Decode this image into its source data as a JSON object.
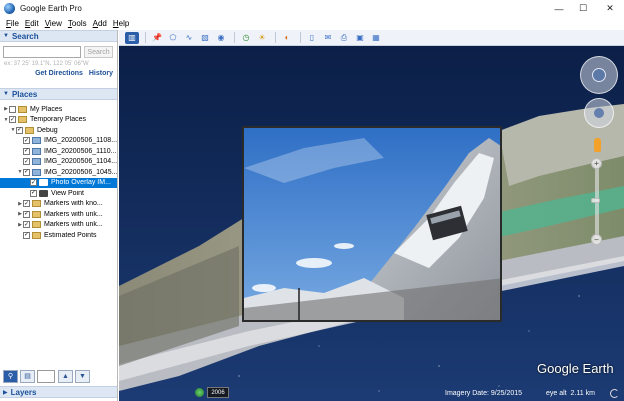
{
  "window": {
    "title": "Google Earth Pro",
    "minimize": "—",
    "maximize": "☐",
    "close": "✕"
  },
  "menu": [
    {
      "label": "File",
      "mn": "F"
    },
    {
      "label": "Edit",
      "mn": "E"
    },
    {
      "label": "View",
      "mn": "V"
    },
    {
      "label": "Tools",
      "mn": "T"
    },
    {
      "label": "Add",
      "mn": "A"
    },
    {
      "label": "Help",
      "mn": "H"
    }
  ],
  "search": {
    "header": "Search",
    "input_value": "",
    "button": "Search",
    "coords_hint": "ex: 37 25' 19.1\"N, 122 05' 06\"W",
    "get_directions": "Get Directions",
    "history": "History"
  },
  "places": {
    "header": "Places",
    "rows": [
      {
        "label": "My Places",
        "checked": false,
        "expander": "▶",
        "icon": "folder",
        "indent": 0,
        "selected": false
      },
      {
        "label": "Temporary Places",
        "checked": true,
        "expander": "▼",
        "icon": "folder",
        "indent": 0,
        "selected": false
      },
      {
        "label": "Debug",
        "checked": true,
        "expander": "▼",
        "icon": "folder",
        "indent": 1,
        "selected": false
      },
      {
        "label": "IMG_20200506_1108...",
        "checked": true,
        "expander": "",
        "icon": "img",
        "indent": 2,
        "selected": false
      },
      {
        "label": "IMG_20200506_1110...",
        "checked": true,
        "expander": "",
        "icon": "img",
        "indent": 2,
        "selected": false
      },
      {
        "label": "IMG_20200506_1104...",
        "checked": true,
        "expander": "",
        "icon": "img",
        "indent": 2,
        "selected": false
      },
      {
        "label": "IMG_20200506_1045...",
        "checked": true,
        "expander": "▼",
        "icon": "img",
        "indent": 2,
        "selected": false
      },
      {
        "label": "Photo Overlay IM...",
        "checked": true,
        "expander": "",
        "icon": "camera",
        "indent": 3,
        "selected": true
      },
      {
        "label": "View Point",
        "checked": true,
        "expander": "",
        "icon": "camera",
        "indent": 3,
        "selected": false
      },
      {
        "label": "Markers with kno...",
        "checked": true,
        "expander": "▶",
        "icon": "folder",
        "indent": 2,
        "selected": false
      },
      {
        "label": "Markers with unk...",
        "checked": true,
        "expander": "▶",
        "icon": "folder",
        "indent": 2,
        "selected": false
      },
      {
        "label": "Markers with unk...",
        "checked": true,
        "expander": "▶",
        "icon": "folder",
        "indent": 2,
        "selected": false
      },
      {
        "label": "Estimated Points",
        "checked": true,
        "expander": "",
        "icon": "folder",
        "indent": 2,
        "selected": false
      }
    ]
  },
  "layers": {
    "header": "Layers"
  },
  "toolbar": {
    "buttons": [
      "sidebar-toggle",
      "placemark",
      "polygon",
      "path",
      "image-overlay",
      "record-tour",
      "historical-imagery",
      "sun",
      "planets",
      "ruler",
      "email",
      "print",
      "save-image",
      "view-in-maps"
    ]
  },
  "view": {
    "brand": "Google Earth",
    "imagery_date": "Imagery Date: 9/25/2015",
    "eye_alt": "eye alt",
    "eye_alt_value": "2.11 km",
    "history_year": "2006"
  },
  "colors": {
    "accent": "#0078d7",
    "panel_header": "#dde7f4",
    "header_text": "#1b4f9a"
  }
}
